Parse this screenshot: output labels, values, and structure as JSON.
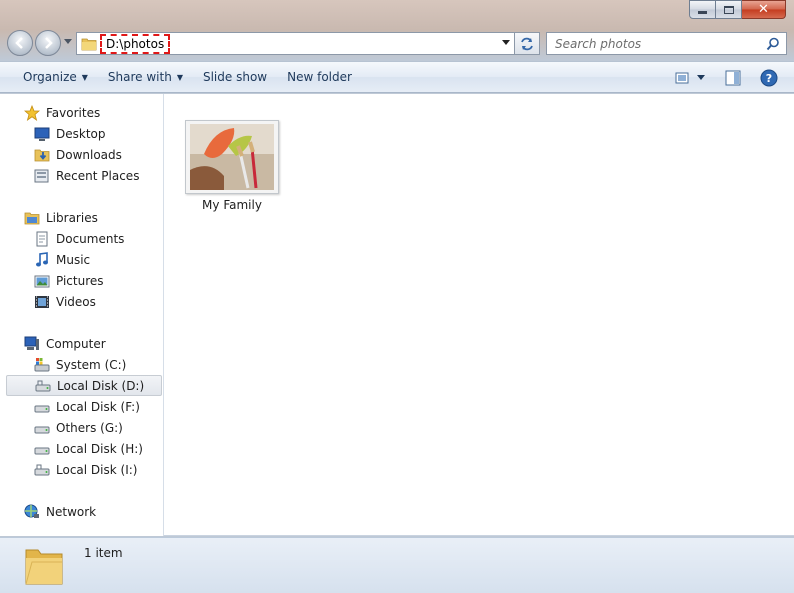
{
  "window": {
    "close_glyph": "✕"
  },
  "address": {
    "path": "D:\\photos"
  },
  "search": {
    "placeholder": "Search photos"
  },
  "toolbar": {
    "organize": "Organize",
    "share_with": "Share with",
    "slide_show": "Slide show",
    "new_folder": "New folder",
    "caret": "▼"
  },
  "nav": {
    "favorites": {
      "label": "Favorites",
      "items": [
        "Desktop",
        "Downloads",
        "Recent Places"
      ]
    },
    "libraries": {
      "label": "Libraries",
      "items": [
        "Documents",
        "Music",
        "Pictures",
        "Videos"
      ]
    },
    "computer": {
      "label": "Computer",
      "items": [
        "System (C:)",
        "Local Disk (D:)",
        "Local Disk (F:)",
        "Others (G:)",
        "Local Disk (H:)",
        "Local Disk (I:)"
      ],
      "selected": "Local Disk (D:)"
    },
    "network": {
      "label": "Network"
    }
  },
  "files": [
    {
      "name": "My Family",
      "type": "folder"
    }
  ],
  "details": {
    "count": "1 item"
  },
  "colors": {
    "accent": "#1e395b",
    "selection_border": "#c7ccd3",
    "address_highlight": "#e01818"
  }
}
